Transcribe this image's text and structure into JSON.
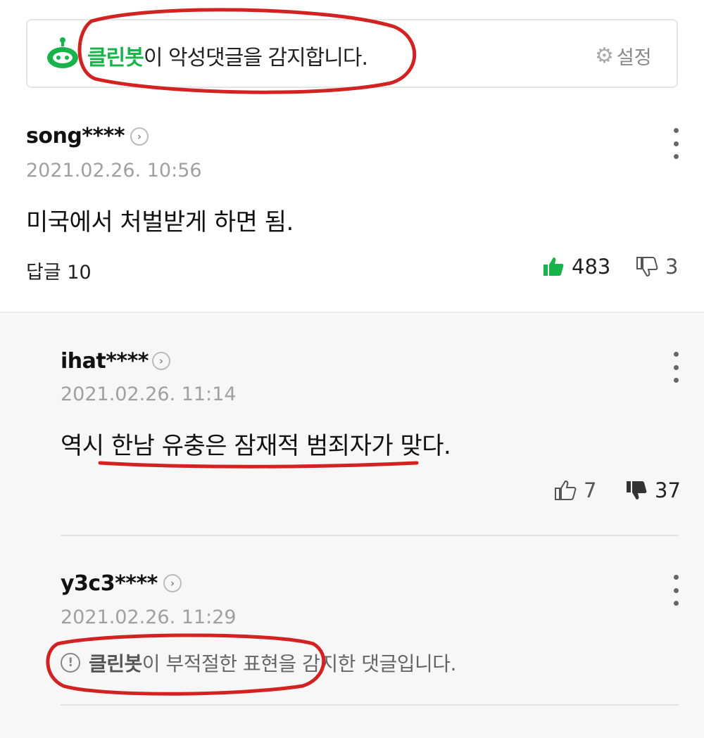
{
  "banner": {
    "brand": "클린봇",
    "text": "이 악성댓글을 감지합니다.",
    "settings_label": "설정"
  },
  "comments": [
    {
      "username": "song****",
      "date": "2021.02.26. 10:56",
      "content": "미국에서 처벌받게 하면 됨.",
      "reply_label": "답글 10",
      "likes": "483",
      "dislikes": "3"
    }
  ],
  "replies": [
    {
      "username": "ihat****",
      "date": "2021.02.26. 11:14",
      "content": "역시 한남 유충은 잠재적 범죄자가 맞다.",
      "likes": "7",
      "dislikes": "37"
    },
    {
      "username": "y3c3****",
      "date": "2021.02.26. 11:29",
      "notice_brand": "클린봇",
      "notice_text": "이 부적절한 표현을 감지한 댓글입니다."
    }
  ],
  "colors": {
    "brand_green": "#19b34b",
    "annotation_red": "#d32222"
  },
  "icons": [
    "robot-icon",
    "gear-icon",
    "chevron-right-icon",
    "more-vertical-icon",
    "thumbs-up-icon",
    "thumbs-down-icon",
    "exclamation-circle-icon"
  ]
}
